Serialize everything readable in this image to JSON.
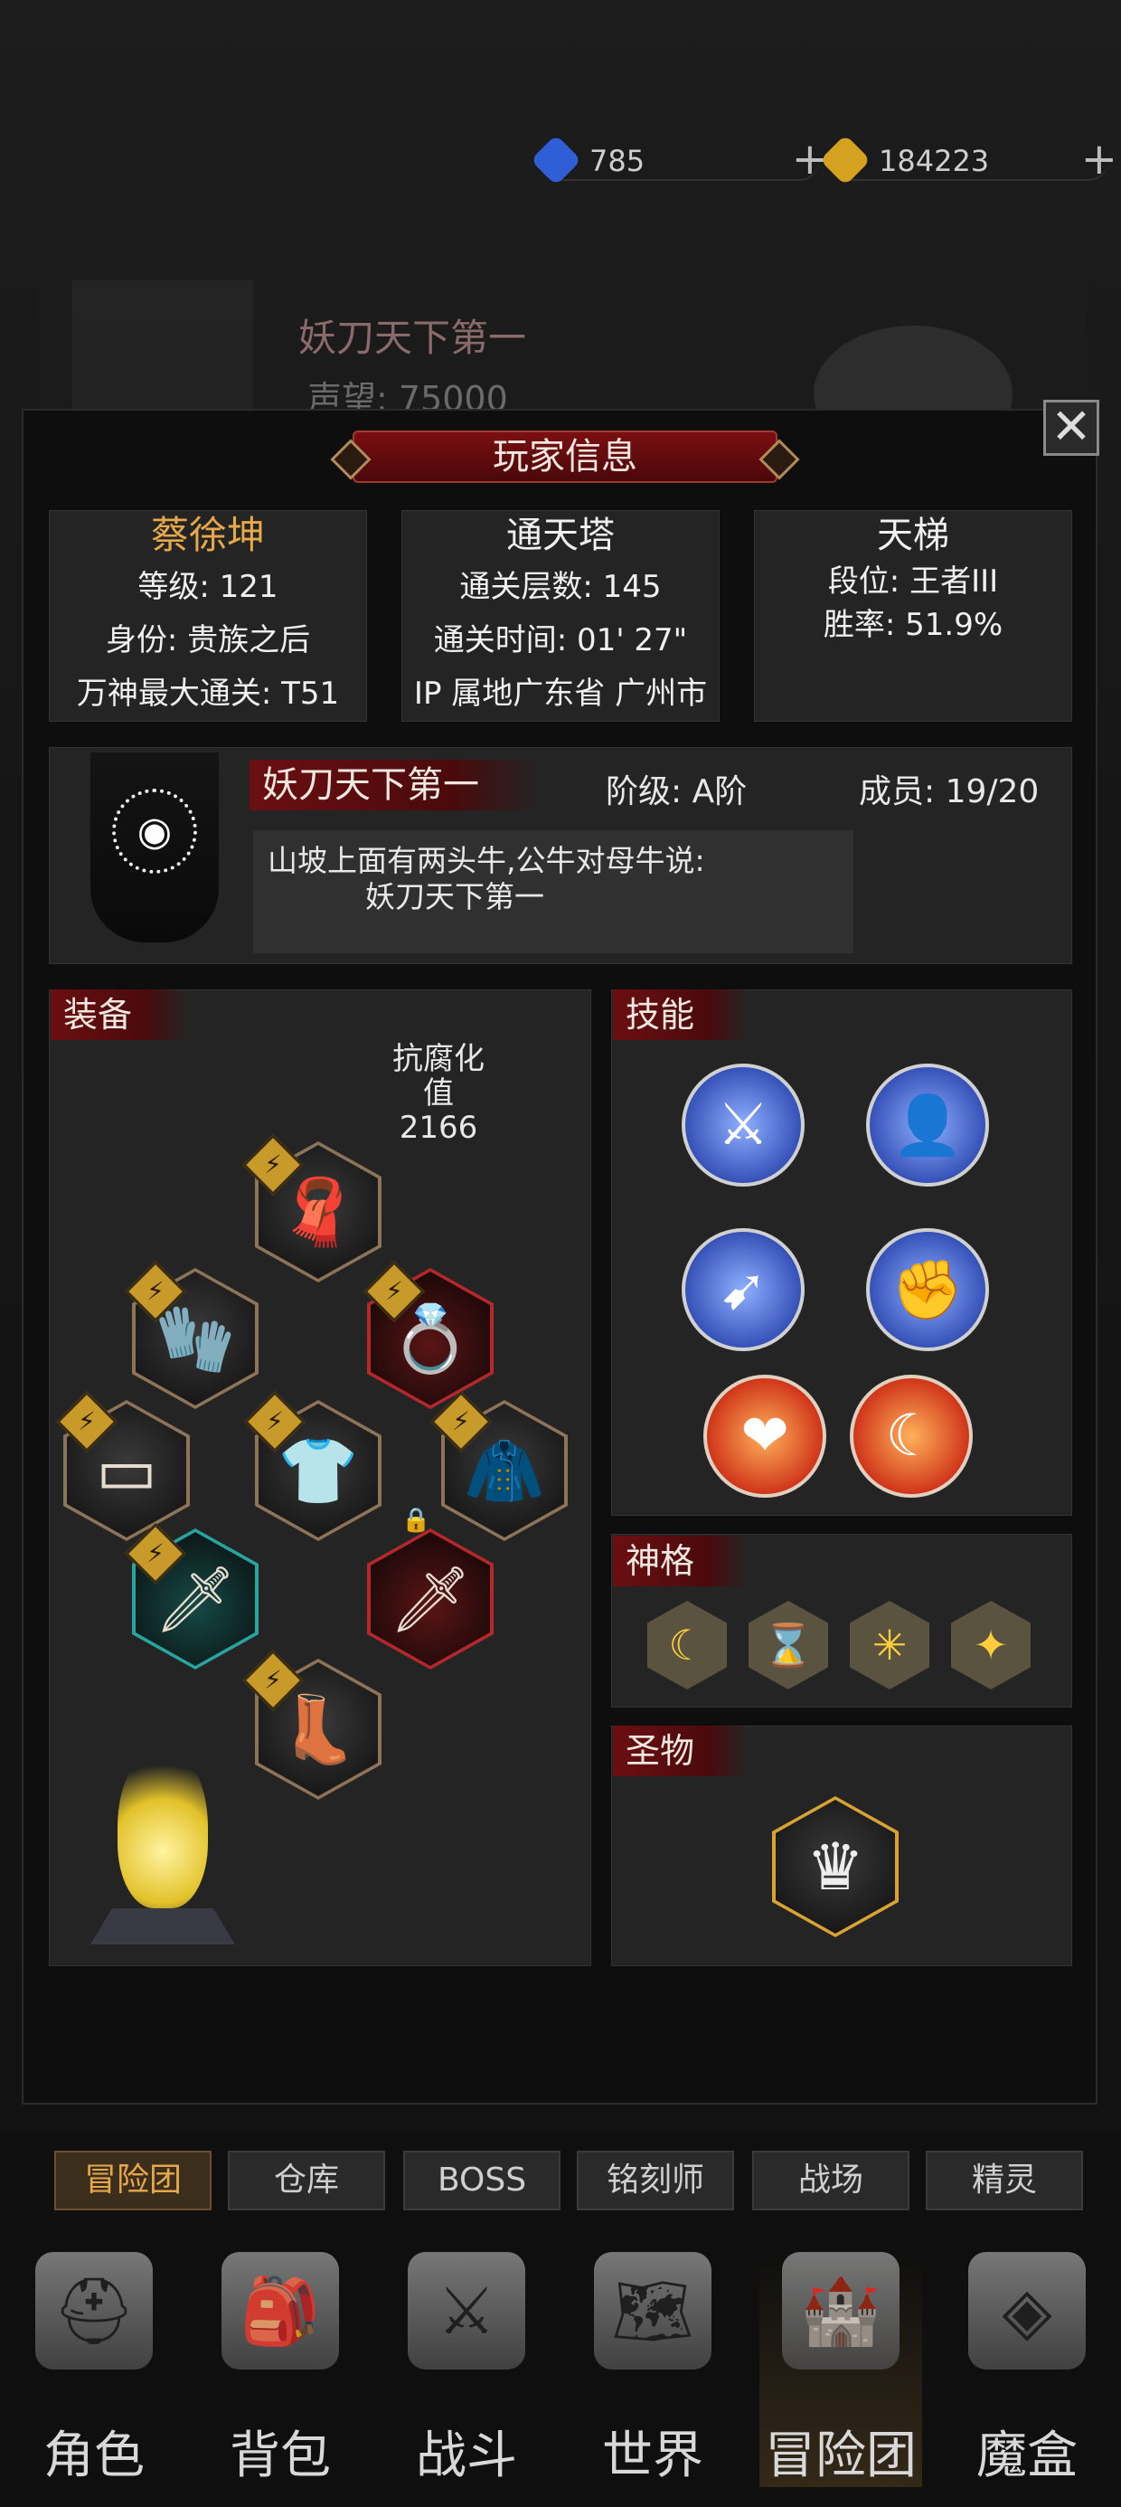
{
  "currency": {
    "gems": "785",
    "gold": "184223"
  },
  "background": {
    "guild_name": "妖刀天下第一",
    "reputation_label": "声望:",
    "reputation_value": "75000"
  },
  "modal": {
    "title": "玩家信息",
    "close_icon": "close-icon",
    "player": {
      "name": "蔡徐坤",
      "level": "等级: 121",
      "identity": "身份: 贵族之后",
      "max_clear": "万神最大通关: T51"
    },
    "tower": {
      "title": "通天塔",
      "floors": "通关层数: 145",
      "time": "通关时间: 01' 27\"",
      "ip": "IP 属地广东省 广州市"
    },
    "ladder": {
      "title": "天梯",
      "rank": "段位: 王者III",
      "winrate": "胜率: 51.9%"
    },
    "guild": {
      "name": "妖刀天下第一",
      "tier": "阶级: A阶",
      "members": "成员: 19/20",
      "motto_line1": "山坡上面有两头牛,公牛对母牛说:",
      "motto_line2": "妖刀天下第一"
    },
    "equipment": {
      "label": "装备",
      "resist_label": "抗腐化值",
      "resist_value": "2166"
    },
    "skills": {
      "label": "技能"
    },
    "divinity": {
      "label": "神格"
    },
    "relic": {
      "label": "圣物"
    }
  },
  "tabs": [
    "冒险团",
    "仓库",
    "BOSS",
    "铭刻师",
    "战场",
    "精灵"
  ],
  "nav": [
    "角色",
    "背包",
    "战斗",
    "世界",
    "冒险团",
    "魔盒"
  ],
  "colors": {
    "accent_gold": "#e6a84a",
    "tag_red": "#6b0f12"
  }
}
